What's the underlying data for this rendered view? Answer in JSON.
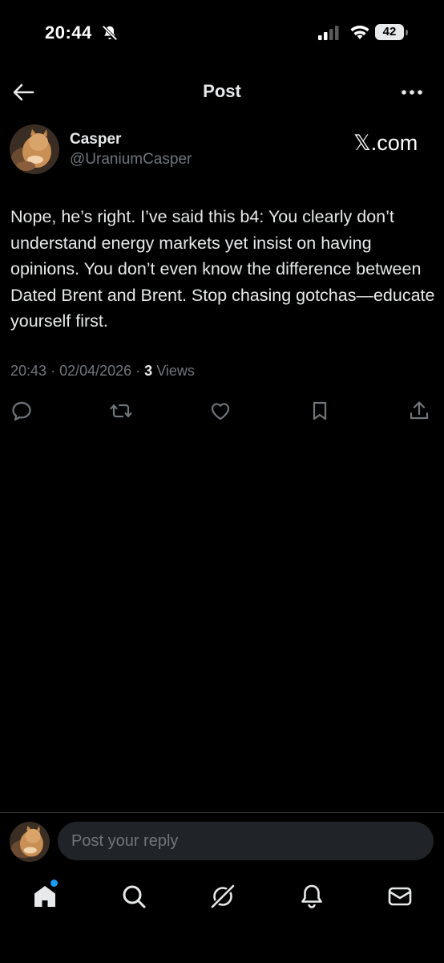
{
  "status_bar": {
    "time": "20:44",
    "battery": "42"
  },
  "header": {
    "title": "Post"
  },
  "post": {
    "author_name": "Casper",
    "author_handle": "@UraniumCasper",
    "brand": "𝕏.com",
    "text": "Nope, he’s right. I’ve said this b4: You clearly don’t understand energy markets yet insist on having opinions. You don’t even know the difference between Dated Brent and Brent. Stop chasing gotchas—educate yourself first.",
    "time": "20:43",
    "date": "02/04/2026",
    "views_count": "3",
    "views_label": "Views"
  },
  "actions": [
    "reply-icon",
    "repost-icon",
    "like-icon",
    "bookmark-icon",
    "share-icon"
  ],
  "reply": {
    "placeholder": "Post your reply"
  },
  "bottom_nav": [
    "home-icon",
    "search-icon",
    "grok-icon",
    "notifications-icon",
    "messages-icon"
  ],
  "colors": {
    "background": "#000000",
    "text": "#e7e9ea",
    "secondary_text": "#71767b",
    "accent": "#1d9bf0"
  }
}
